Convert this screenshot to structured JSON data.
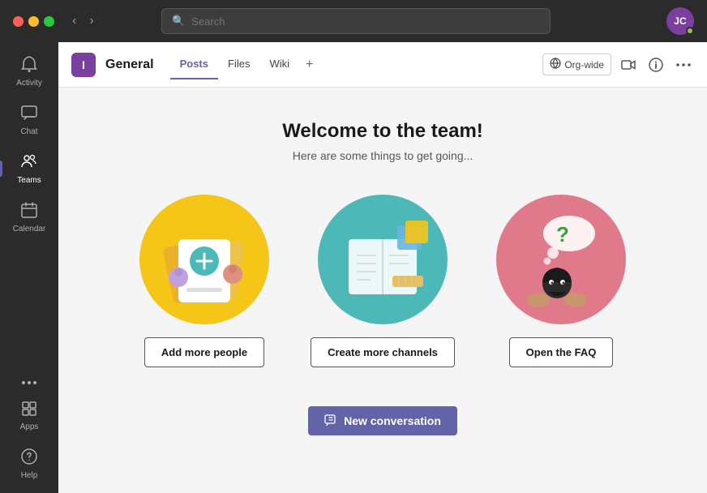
{
  "titlebar": {
    "search_placeholder": "Search",
    "avatar_initials": "JC",
    "nav_back": "‹",
    "nav_forward": "›"
  },
  "sidebar": {
    "items": [
      {
        "id": "activity",
        "label": "Activity",
        "icon": "🔔",
        "active": false
      },
      {
        "id": "chat",
        "label": "Chat",
        "icon": "💬",
        "active": false
      },
      {
        "id": "teams",
        "label": "Teams",
        "icon": "👥",
        "active": true
      },
      {
        "id": "calendar",
        "label": "Calendar",
        "icon": "📅",
        "active": false
      }
    ],
    "more_label": "...",
    "apps_label": "Apps",
    "help_label": "Help"
  },
  "channel_header": {
    "team_initial": "I",
    "channel_name": "General",
    "tabs": [
      {
        "id": "posts",
        "label": "Posts",
        "active": true
      },
      {
        "id": "files",
        "label": "Files",
        "active": false
      },
      {
        "id": "wiki",
        "label": "Wiki",
        "active": false
      }
    ],
    "org_wide_label": "Org-wide"
  },
  "main": {
    "welcome_title": "Welcome to the team!",
    "welcome_subtitle": "Here are some things to get going...",
    "action_cards": [
      {
        "id": "add-people",
        "button_label": "Add more people",
        "circle_color": "#f5c518"
      },
      {
        "id": "create-channels",
        "button_label": "Create more channels",
        "circle_color": "#4db8b8"
      },
      {
        "id": "open-faq",
        "button_label": "Open the FAQ",
        "circle_color": "#e07a8a"
      }
    ],
    "new_conversation_label": "New conversation"
  }
}
